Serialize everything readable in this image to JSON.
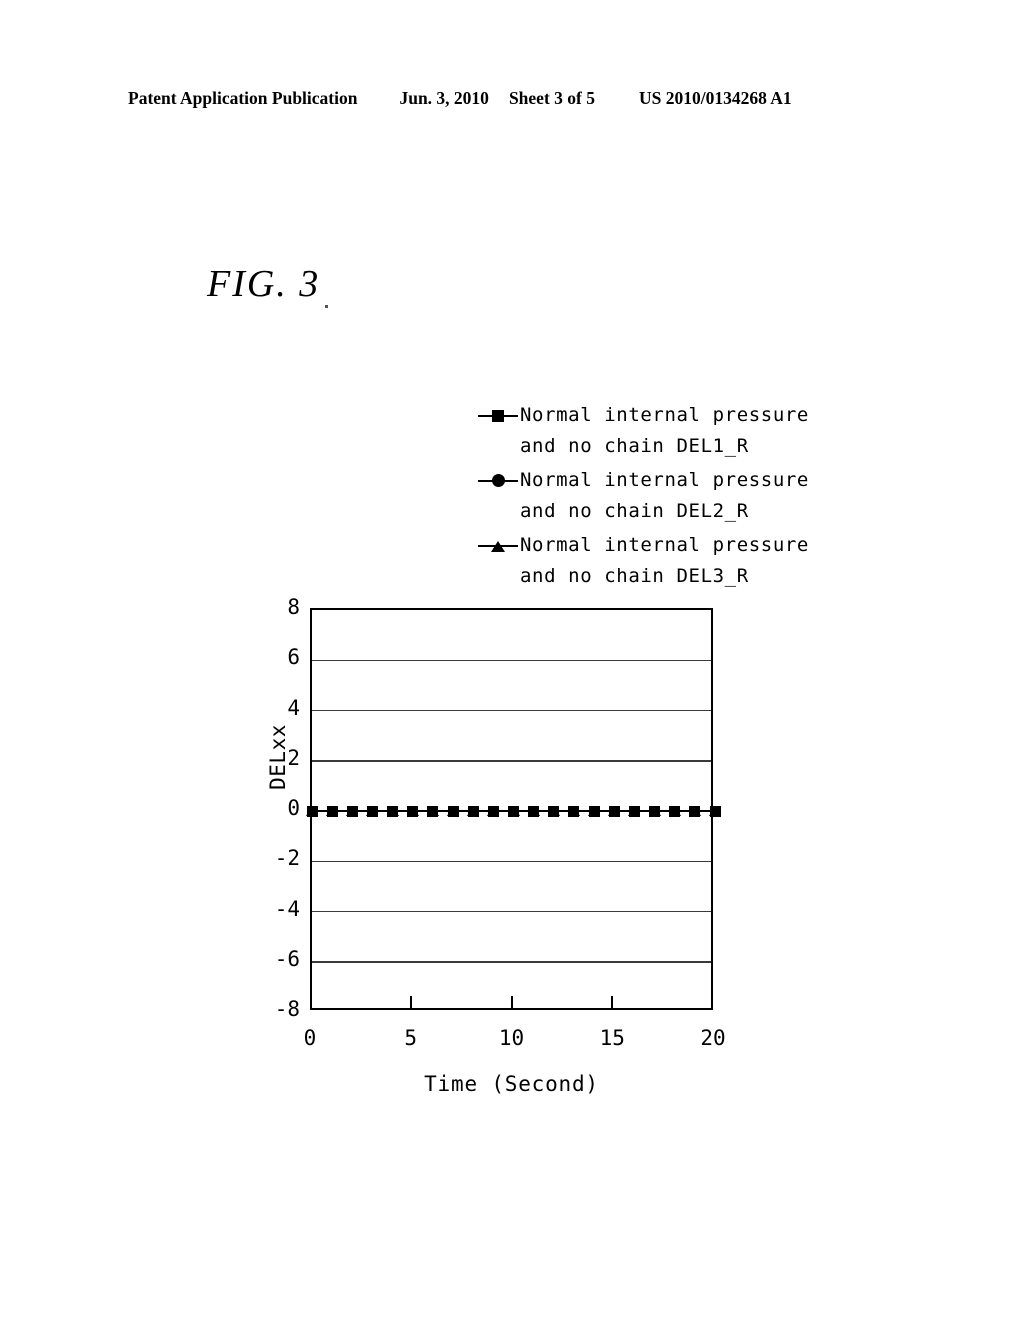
{
  "header": {
    "publication": "Patent Application Publication",
    "date": "Jun. 3, 2010",
    "sheet": "Sheet 3 of 5",
    "number": "US 2010/0134268 A1"
  },
  "figure": {
    "label": "FIG. 3"
  },
  "chart_data": {
    "type": "line",
    "title": "",
    "xlabel": "Time (Second)",
    "ylabel": "DELxx",
    "xlim": [
      0,
      20
    ],
    "ylim": [
      -8,
      8
    ],
    "xticks": [
      "0",
      "5",
      "10",
      "15",
      "20"
    ],
    "xtick_values": [
      0,
      5,
      10,
      15,
      20
    ],
    "yticks": [
      "8",
      "6",
      "4",
      "2",
      "0",
      "-2",
      "-4",
      "-6",
      "-8"
    ],
    "ytick_values": [
      8,
      6,
      4,
      2,
      0,
      -2,
      -4,
      -6,
      -8
    ],
    "grid": true,
    "legend_position": "above-plot",
    "x": [
      0,
      1,
      2,
      3,
      4,
      5,
      6,
      7,
      8,
      9,
      10,
      11,
      12,
      13,
      14,
      15,
      16,
      17,
      18,
      19,
      20
    ],
    "series": [
      {
        "name": "Normal internal pressure and no chain DEL1_R",
        "name_line1": "Normal internal pressure",
        "name_line2": "and no chain DEL1_R",
        "marker": "square",
        "color": "#000000",
        "values": [
          0,
          0,
          0,
          0,
          0,
          0,
          0,
          0,
          0,
          0,
          0,
          0,
          0,
          0,
          0,
          0,
          0,
          0,
          0,
          0,
          0
        ]
      },
      {
        "name": "Normal internal pressure and no chain DEL2_R",
        "name_line1": "Normal internal pressure",
        "name_line2": "and no chain DEL2_R",
        "marker": "circle",
        "color": "#000000",
        "values": [
          0,
          0,
          0,
          0,
          0,
          0,
          0,
          0,
          0,
          0,
          0,
          0,
          0,
          0,
          0,
          0,
          0,
          0,
          0,
          0,
          0
        ]
      },
      {
        "name": "Normal internal pressure and no chain DEL3_R",
        "name_line1": "Normal internal pressure",
        "name_line2": "and no chain DEL3_R",
        "marker": "triangle",
        "color": "#000000",
        "values": [
          0,
          0,
          0,
          0,
          0,
          0,
          0,
          0,
          0,
          0,
          0,
          0,
          0,
          0,
          0,
          0,
          0,
          0,
          0,
          0,
          0
        ]
      }
    ]
  }
}
